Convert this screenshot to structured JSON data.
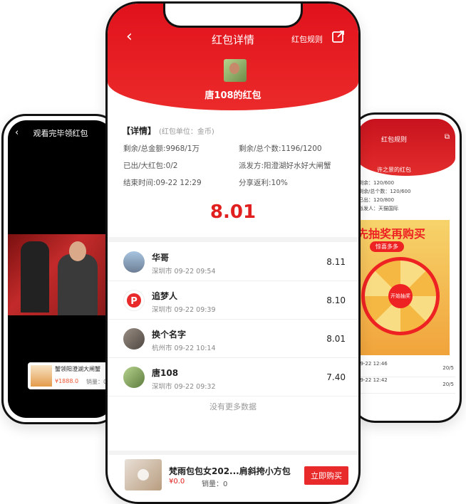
{
  "left_phone": {
    "title": "观看完毕领红包",
    "product_title": "蟹领阳澄湖大闸蟹",
    "product_price": "¥1888.0",
    "product_sales": "销量：0"
  },
  "right_phone": {
    "rule": "红包规则",
    "owner": "许之景的红包",
    "info1": "剩余：120/600",
    "info2": "剩余/总个数：120/600",
    "info3": "已出：120/800",
    "info4": "派发人：天猫国际",
    "banner_title": "先抽奖再购买",
    "banner_tag": "惊喜多多",
    "wheel_center": "开始抽奖",
    "rows": [
      {
        "label": "09-22 12:46",
        "value": "20/5"
      },
      {
        "label": "09-22 12:42",
        "value": "20/5"
      }
    ]
  },
  "header": {
    "back_label": "‹",
    "title": "红包详情",
    "rule_label": "红包规则",
    "owner": "唐108的红包"
  },
  "details": {
    "heading": "【详情】",
    "unit": "(红包单位：金币)",
    "remaining_amount": "剩余/总金额:9968/1万",
    "remaining_count": "剩余/总个数:1196/1200",
    "issued": "已出/大红包:0/2",
    "distributor": "派发方:阳澄湖好水好大闸蟹",
    "end_time": "结束时间:09-22 12:29",
    "share_rebate": "分享返利:10%"
  },
  "amount": "8.01",
  "recipients": [
    {
      "name": "华哥",
      "meta": "深圳市 09-22 09:54",
      "value": "8.11"
    },
    {
      "name": "追梦人",
      "meta": "深圳市 09-22 09:39",
      "value": "8.10"
    },
    {
      "name": "换个名字",
      "meta": "杭州市 09-22 10:14",
      "value": "8.01"
    },
    {
      "name": "唐108",
      "meta": "深圳市 09-22 09:32",
      "value": "7.40"
    }
  ],
  "no_more": "没有更多数据",
  "product": {
    "name": "梵雨包包女202...肩斜挎小方包",
    "price": "¥0.0",
    "sales": "销量：0",
    "buy_label": "立即购买"
  },
  "colors": {
    "accent": "#e11f1f",
    "header": "#e0121c"
  }
}
